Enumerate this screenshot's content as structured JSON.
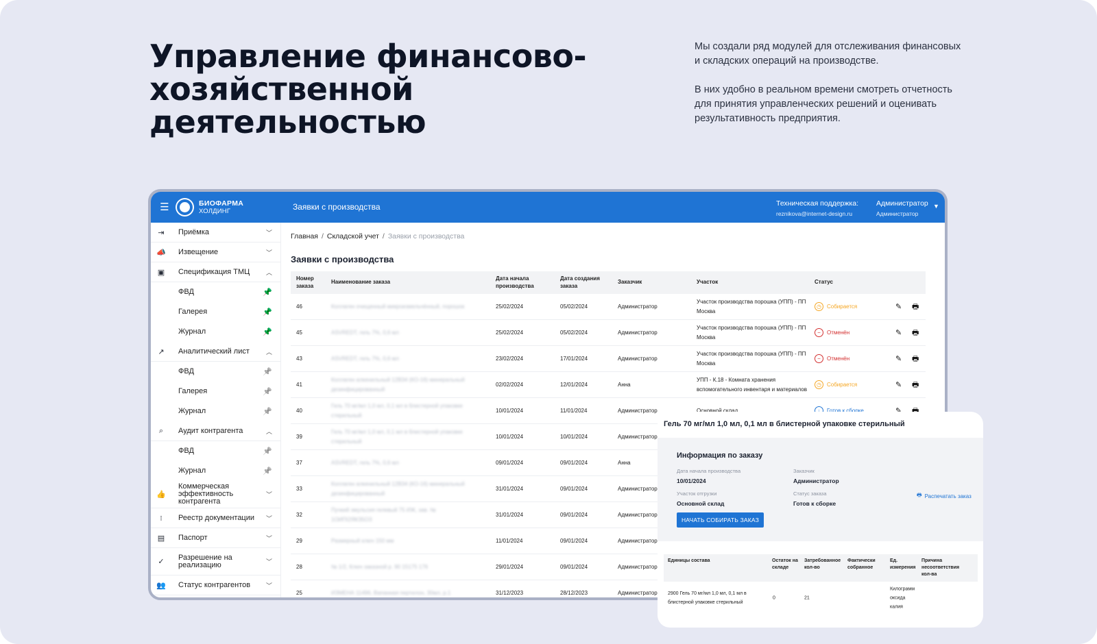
{
  "hero": {
    "title": "Управление финансово-хозяйственной деятельностью",
    "desc1": "Мы создали ряд модулей для отслеживания финансовых и складских операций на производстве.",
    "desc2": "В них удобно в реальном времени смотреть отчетность для принятия управленческих решений и оценивать результативность предприятия."
  },
  "appbar": {
    "brand": "БИОФАРМА",
    "brand_sub": "ХОЛДИНГ",
    "title": "Заявки с производства",
    "support_label": "Техническая поддержка:",
    "support_email": "reznikova@internet-design.ru",
    "user_name": "Администратор",
    "user_role": "Администратор"
  },
  "sidebar": [
    {
      "label": "Приёмка",
      "icon": "login-icon",
      "glyph": "⇥",
      "type": "group",
      "state": "collapsed"
    },
    {
      "label": "Извещение",
      "icon": "megaphone-icon",
      "glyph": "📣",
      "type": "group",
      "state": "collapsed"
    },
    {
      "label": "Спецификация ТМЦ",
      "icon": "clipboard-icon",
      "glyph": "▣",
      "type": "group",
      "state": "expanded"
    },
    {
      "label": "ФВД",
      "type": "sub",
      "pin": "active"
    },
    {
      "label": "Галерея",
      "type": "sub",
      "pin": "active"
    },
    {
      "label": "Журнал",
      "type": "sub",
      "pin": "active"
    },
    {
      "label": "Аналитический лист",
      "icon": "analytics-icon",
      "glyph": "↗",
      "type": "group",
      "state": "expanded"
    },
    {
      "label": "ФВД",
      "type": "sub",
      "pin": "inactive"
    },
    {
      "label": "Галерея",
      "type": "sub",
      "pin": "inactive"
    },
    {
      "label": "Журнал",
      "type": "sub",
      "pin": "inactive"
    },
    {
      "label": "Аудит контрагента",
      "icon": "search-icon",
      "glyph": "⌕",
      "type": "group",
      "state": "expanded"
    },
    {
      "label": "ФВД",
      "type": "sub",
      "pin": "inactive"
    },
    {
      "label": "Журнал",
      "type": "sub",
      "pin": "inactive"
    },
    {
      "label": "Коммерческая эффективность контрагента",
      "icon": "thumb-up-icon",
      "glyph": "👍",
      "type": "group",
      "state": "collapsed",
      "tall": true
    },
    {
      "label": "Реестр документации",
      "icon": "registry-icon",
      "glyph": "⁝",
      "type": "group",
      "state": "collapsed"
    },
    {
      "label": "Паспорт",
      "icon": "passport-icon",
      "glyph": "▤",
      "type": "group",
      "state": "collapsed"
    },
    {
      "label": "Разрешение на реализацию",
      "icon": "check-circle-icon",
      "glyph": "✓",
      "type": "group",
      "state": "collapsed",
      "tall": true
    },
    {
      "label": "Статус контрагентов",
      "icon": "people-icon",
      "glyph": "👥",
      "type": "group",
      "state": "collapsed"
    }
  ],
  "colors": {
    "pin_active": "#1a9e6e",
    "pin_inactive": "#8a8f99",
    "assembling": "#f5a623",
    "cancelled": "#d32f2f",
    "ready": "#1f74d4"
  },
  "breadcrumb": {
    "home": "Главная",
    "section": "Складской учет",
    "current": "Заявки с производства"
  },
  "page_title": "Заявки с производства",
  "table": {
    "headers": [
      "Номер заказа",
      "Наименование заказа",
      "Дата начала производства",
      "Дата создания заказа",
      "Заказчик",
      "Участок",
      "Статус"
    ],
    "rows": [
      {
        "num": "46",
        "name": "Коллаген очищенный микроизмельчённый, порошок",
        "start": "25/02/2024",
        "created": "05/02/2024",
        "customer": "Администратор",
        "site": "Участок производства порошка (УПП) - ПП Москва",
        "status": "Собирается",
        "st": "assembling"
      },
      {
        "num": "45",
        "name": "ASVREDT, гель 7%, 0,6 мл",
        "start": "25/02/2024",
        "created": "05/02/2024",
        "customer": "Администратор",
        "site": "Участок производства порошка (УПП) - ПП Москва",
        "status": "Отменён",
        "st": "cancelled"
      },
      {
        "num": "43",
        "name": "ASVREDT, гель 7%, 0,6 мл",
        "start": "23/02/2024",
        "created": "17/01/2024",
        "customer": "Администратор",
        "site": "Участок производства порошка (УПП) - ПП Москва",
        "status": "Отменён",
        "st": "cancelled"
      },
      {
        "num": "41",
        "name": "Коллаген алкенильный 12В34 (КО-16) минеральный дезинфицированный",
        "start": "02/02/2024",
        "created": "12/01/2024",
        "customer": "Анна",
        "site": "УПП - К.18 - Комната хранения вспомогательного инвентаря и материалов",
        "status": "Собирается",
        "st": "assembling"
      },
      {
        "num": "40",
        "name": "Гель 70 мг/мл 1,0 мл, 0,1 мл в блистерной упаковке стерильный",
        "start": "10/01/2024",
        "created": "11/01/2024",
        "customer": "Администратор",
        "site": "Основной склад",
        "status": "Готов к сборке",
        "st": "ready"
      },
      {
        "num": "39",
        "name": "Гель 70 мг/мл 1,0 мл, 0,1 мл в блистерной упаковке стерильный",
        "start": "10/01/2024",
        "created": "10/01/2024",
        "customer": "Администратор",
        "site": "",
        "status": "",
        "st": ""
      },
      {
        "num": "37",
        "name": "ASVREDT, гель 7%, 0,6 мл",
        "start": "09/01/2024",
        "created": "09/01/2024",
        "customer": "Анна",
        "site": "",
        "status": "",
        "st": ""
      },
      {
        "num": "33",
        "name": "Коллаген алкенильный 12В34 (КО-16) минеральный дезинфицированный",
        "start": "31/01/2024",
        "created": "09/01/2024",
        "customer": "Администратор",
        "site": "",
        "status": "",
        "st": ""
      },
      {
        "num": "32",
        "name": "Пучкий эмульсия гелевый 75 ИЖ, зав. № 1ОИПІ2ЯКЗ5ОЗ",
        "start": "31/01/2024",
        "created": "09/01/2024",
        "customer": "Администратор",
        "site": "",
        "status": "",
        "st": ""
      },
      {
        "num": "29",
        "name": "Размерный ключ 150 мм",
        "start": "11/01/2024",
        "created": "09/01/2024",
        "customer": "Администратор",
        "site": "",
        "status": "",
        "st": ""
      },
      {
        "num": "28",
        "name": "№ 1/2, Ключ заказной р. 90 15175 176",
        "start": "29/01/2024",
        "created": "09/01/2024",
        "customer": "Администратор",
        "site": "",
        "status": "",
        "st": ""
      },
      {
        "num": "25",
        "name": "ИЗМЕНА 11496, Вапанная пертилон, 30мл, р.1",
        "start": "31/12/2023",
        "created": "28/12/2023",
        "customer": "Администратор",
        "site": "",
        "status": "",
        "st": ""
      }
    ]
  },
  "card": {
    "title": "Гель 70 мг/мл 1,0 мл, 0,1 мл в блистерной упаковке стерильный",
    "info_title": "Информация по заказу",
    "start_label": "Дата начала производства",
    "start_value": "10/01/2024",
    "customer_label": "Заказчик",
    "customer_value": "Администратор",
    "ship_label": "Участок отгрузки",
    "ship_value": "Основной склад",
    "status_label": "Статус заказа",
    "status_value": "Готов к сборке",
    "start_button": "НАЧАТЬ СОБИРАТЬ ЗАКАЗ",
    "print_label": "Распечатать заказ",
    "table_headers": [
      "Единицы состава",
      "Остаток на складе",
      "Затребованное кол-во",
      "Фактически собранное",
      "Ед. измерения",
      "Причина несоответствия кол-ва"
    ],
    "row": {
      "unit": "2900 Гель 70 мг/мл 1,0 мл, 0,1 мл в блистерной упаковке стерильный",
      "stock": "0",
      "requested": "21",
      "collected": "",
      "measure": "Килограмм оксида калия",
      "reason": ""
    }
  }
}
